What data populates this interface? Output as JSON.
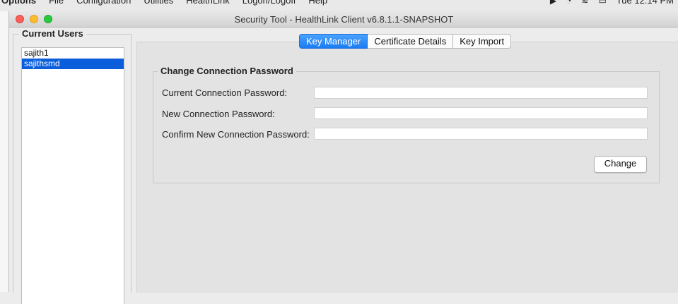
{
  "menubar": {
    "items": [
      "Options",
      "File",
      "Configuration",
      "Utilities",
      "HealthLink",
      "Logon/Logoff",
      "Help"
    ],
    "clock": "Tue 12:14 PM"
  },
  "window": {
    "title": "Security Tool - HealthLink Client v6.8.1.1-SNAPSHOT"
  },
  "users": {
    "legend": "Current Users",
    "list": [
      {
        "name": "sajith1",
        "selected": false
      },
      {
        "name": "sajithsmd",
        "selected": true
      }
    ]
  },
  "tabs": [
    {
      "label": "Key Manager",
      "active": true
    },
    {
      "label": "Certificate Details",
      "active": false
    },
    {
      "label": "Key Import",
      "active": false
    }
  ],
  "password_group": {
    "legend": "Change Connection Password",
    "fields": [
      {
        "label": "Current Connection Password:",
        "value": ""
      },
      {
        "label": "New Connection Password:",
        "value": ""
      },
      {
        "label": "Confirm New Connection Password:",
        "value": ""
      }
    ],
    "change_label": "Change"
  },
  "colors": {
    "accent": "#1a7bf2",
    "selection": "#0a5edc"
  }
}
